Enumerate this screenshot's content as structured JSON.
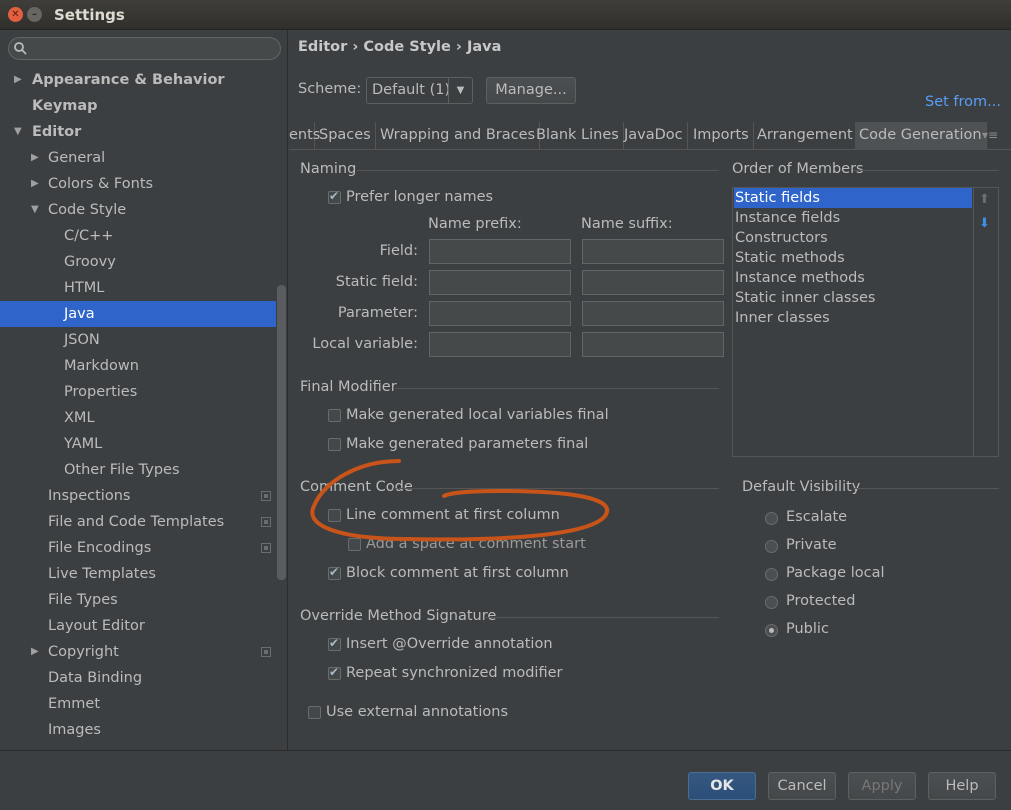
{
  "window": {
    "title": "Settings"
  },
  "sidebar": {
    "search_placeholder": "",
    "items": [
      {
        "label": "Appearance & Behavior",
        "arrow": "▶"
      },
      {
        "label": "Keymap",
        "arrow": ""
      },
      {
        "label": "Editor",
        "arrow": "▼"
      },
      {
        "label": "General",
        "arrow": "▶"
      },
      {
        "label": "Colors & Fonts",
        "arrow": "▶"
      },
      {
        "label": "Code Style",
        "arrow": "▼"
      },
      {
        "label": "C/C++",
        "arrow": ""
      },
      {
        "label": "Groovy",
        "arrow": ""
      },
      {
        "label": "HTML",
        "arrow": ""
      },
      {
        "label": "Java",
        "arrow": ""
      },
      {
        "label": "JSON",
        "arrow": ""
      },
      {
        "label": "Markdown",
        "arrow": ""
      },
      {
        "label": "Properties",
        "arrow": ""
      },
      {
        "label": "XML",
        "arrow": ""
      },
      {
        "label": "YAML",
        "arrow": ""
      },
      {
        "label": "Other File Types",
        "arrow": ""
      },
      {
        "label": "Inspections",
        "arrow": ""
      },
      {
        "label": "File and Code Templates",
        "arrow": ""
      },
      {
        "label": "File Encodings",
        "arrow": ""
      },
      {
        "label": "Live Templates",
        "arrow": ""
      },
      {
        "label": "File Types",
        "arrow": ""
      },
      {
        "label": "Layout Editor",
        "arrow": ""
      },
      {
        "label": "Copyright",
        "arrow": "▶"
      },
      {
        "label": "Data Binding",
        "arrow": ""
      },
      {
        "label": "Emmet",
        "arrow": ""
      },
      {
        "label": "Images",
        "arrow": ""
      }
    ]
  },
  "header": {
    "breadcrumb": "Editor › Code Style › Java",
    "scheme_label": "Scheme:",
    "scheme_value": "Default (1)",
    "manage_label": "Manage...",
    "set_from_label": "Set from..."
  },
  "tabs": [
    "ents",
    "Spaces",
    "Wrapping and Braces",
    "Blank Lines",
    "JavaDoc",
    "Imports",
    "Arrangement",
    "Code Generation"
  ],
  "naming": {
    "title": "Naming",
    "prefer_longer": "Prefer longer names",
    "prefix_header": "Name prefix:",
    "suffix_header": "Name suffix:",
    "fields": [
      "Field:",
      "Static field:",
      "Parameter:",
      "Local variable:"
    ]
  },
  "final_modifier": {
    "title": "Final Modifier",
    "local_vars": "Make generated local variables final",
    "params": "Make generated parameters final"
  },
  "comment_code": {
    "title": "Comment Code",
    "line_first_col": "Line comment at first column",
    "add_space": "Add a space at comment start",
    "block_first_col": "Block comment at first column"
  },
  "override": {
    "title": "Override Method Signature",
    "insert_override": "Insert @Override annotation",
    "repeat_sync": "Repeat synchronized modifier"
  },
  "external_annotations": "Use external annotations",
  "order_of_members": {
    "title": "Order of Members",
    "items": [
      "Static fields",
      "Instance fields",
      "Constructors",
      "Static methods",
      "Instance methods",
      "Static inner classes",
      "Inner classes"
    ]
  },
  "default_visibility": {
    "title": "Default Visibility",
    "options": [
      "Escalate",
      "Private",
      "Package local",
      "Protected",
      "Public"
    ],
    "selected": "Public"
  },
  "footer": {
    "ok": "OK",
    "cancel": "Cancel",
    "apply": "Apply",
    "help": "Help"
  },
  "colors": {
    "selection": "#2f65ca",
    "link": "#589df6",
    "annotation": "#c8541a"
  }
}
